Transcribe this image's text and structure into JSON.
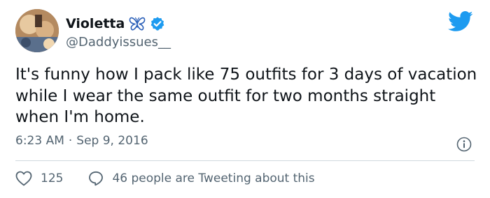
{
  "tweet": {
    "display_name": "Violetta",
    "handle": "@Daddyissues__",
    "text": "It's funny how I pack like 75 outfits for 3 days of vacation while I wear the same outfit for two months straight when I'm home.",
    "time": "6:23 AM",
    "separator": "·",
    "date": "Sep 9, 2016",
    "likes": "125",
    "conversation_text": "46 people are Tweeting about this"
  },
  "icons": {
    "butterfly": "butterfly-emoji-icon",
    "verified": "verified-badge-icon",
    "twitter": "twitter-bird-icon",
    "info": "info-icon",
    "like": "heart-icon",
    "conversation": "speech-bubble-icon"
  },
  "colors": {
    "twitter_blue": "#1d9bf0",
    "text_primary": "#0f1419",
    "text_secondary": "#536471",
    "divider": "#cfd9de"
  }
}
